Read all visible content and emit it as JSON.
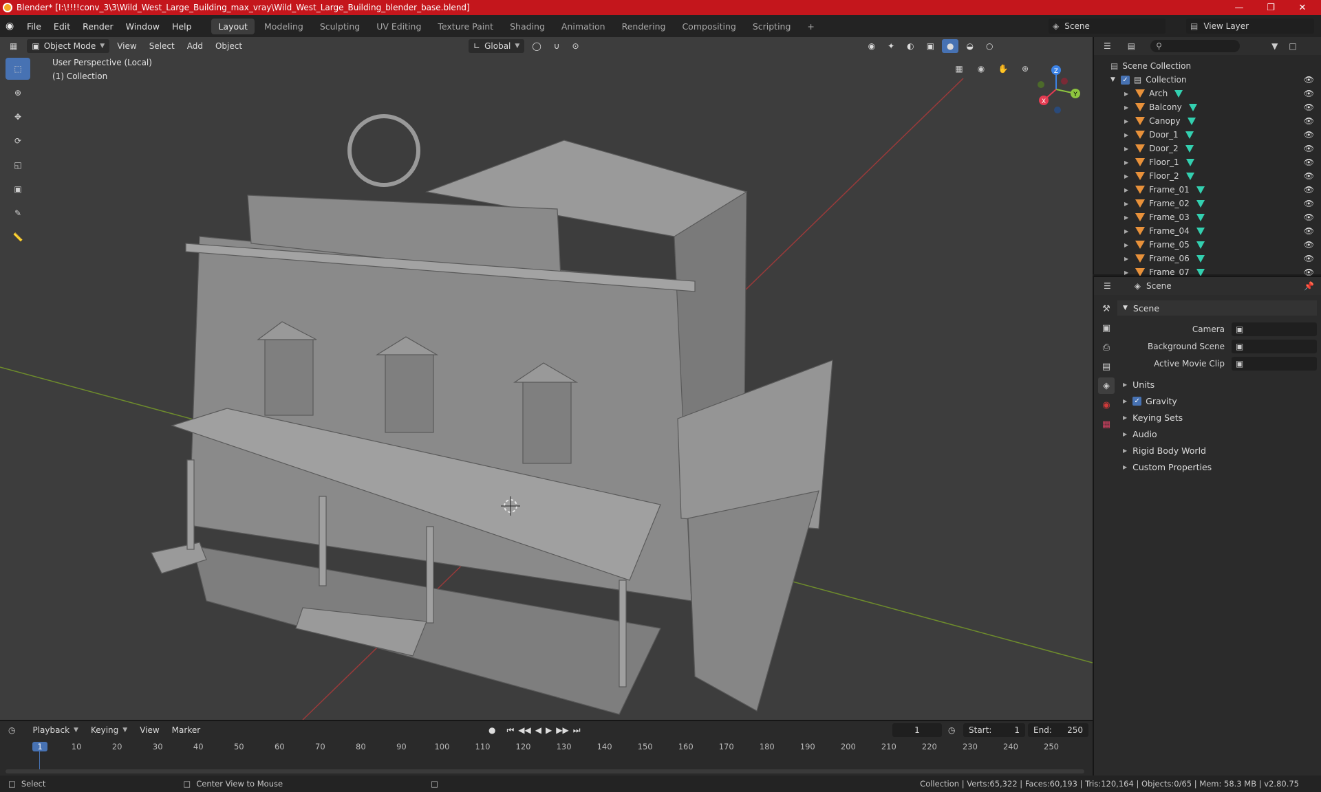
{
  "window": {
    "title": "Blender* [I:\\!!!!conv_3\\3\\Wild_West_Large_Building_max_vray\\Wild_West_Large_Building_blender_base.blend]"
  },
  "menu": [
    "File",
    "Edit",
    "Render",
    "Window",
    "Help"
  ],
  "workspaces": [
    "Layout",
    "Modeling",
    "Sculpting",
    "UV Editing",
    "Texture Paint",
    "Shading",
    "Animation",
    "Rendering",
    "Compositing",
    "Scripting"
  ],
  "scene_field": "Scene",
  "view_layer_field": "View Layer",
  "header": {
    "mode": "Object Mode",
    "view": "View",
    "select": "Select",
    "add": "Add",
    "object": "Object",
    "orientation": "Global"
  },
  "viewport": {
    "perspective": "User Perspective (Local)",
    "collection": "(1) Collection"
  },
  "gizmo": {
    "z": "Z",
    "y": "Y",
    "x": "X"
  },
  "outliner": {
    "root": "Scene Collection",
    "collection": "Collection",
    "items": [
      "Arch",
      "Balcony",
      "Canopy",
      "Door_1",
      "Door_2",
      "Floor_1",
      "Floor_2",
      "Frame_01",
      "Frame_02",
      "Frame_03",
      "Frame_04",
      "Frame_05",
      "Frame_06",
      "Frame_07"
    ]
  },
  "properties": {
    "header": "Scene",
    "section": "Scene",
    "fields": [
      {
        "label": "Camera"
      },
      {
        "label": "Background Scene"
      },
      {
        "label": "Active Movie Clip"
      }
    ],
    "panels": [
      {
        "label": "Units",
        "checkbox": false
      },
      {
        "label": "Gravity",
        "checkbox": true
      },
      {
        "label": "Keying Sets",
        "checkbox": false
      },
      {
        "label": "Audio",
        "checkbox": false
      },
      {
        "label": "Rigid Body World",
        "checkbox": false
      },
      {
        "label": "Custom Properties",
        "checkbox": false
      }
    ]
  },
  "timeline": {
    "menus": [
      "Playback",
      "Keying",
      "View",
      "Marker"
    ],
    "current_frame": "1",
    "start_label": "Start:",
    "start": "1",
    "end_label": "End:",
    "end": "250",
    "ticks": [
      "1",
      "10",
      "20",
      "30",
      "40",
      "50",
      "60",
      "70",
      "80",
      "90",
      "100",
      "110",
      "120",
      "130",
      "140",
      "150",
      "160",
      "170",
      "180",
      "190",
      "200",
      "210",
      "220",
      "230",
      "240",
      "250"
    ]
  },
  "statusbar": {
    "select": "Select",
    "center": "Center View to Mouse",
    "stats": "Collection | Verts:65,322 | Faces:60,193 | Tris:120,164 | Objects:0/65 | Mem: 58.3 MB | v2.80.75"
  },
  "colors": {
    "titlebar": "#c4161c",
    "accent": "#4772b3",
    "object": "#e8913a",
    "mesh": "#33d0b0",
    "x_axis": "#e63c52",
    "y_axis": "#8dc53f",
    "z_axis": "#3b82e6"
  }
}
